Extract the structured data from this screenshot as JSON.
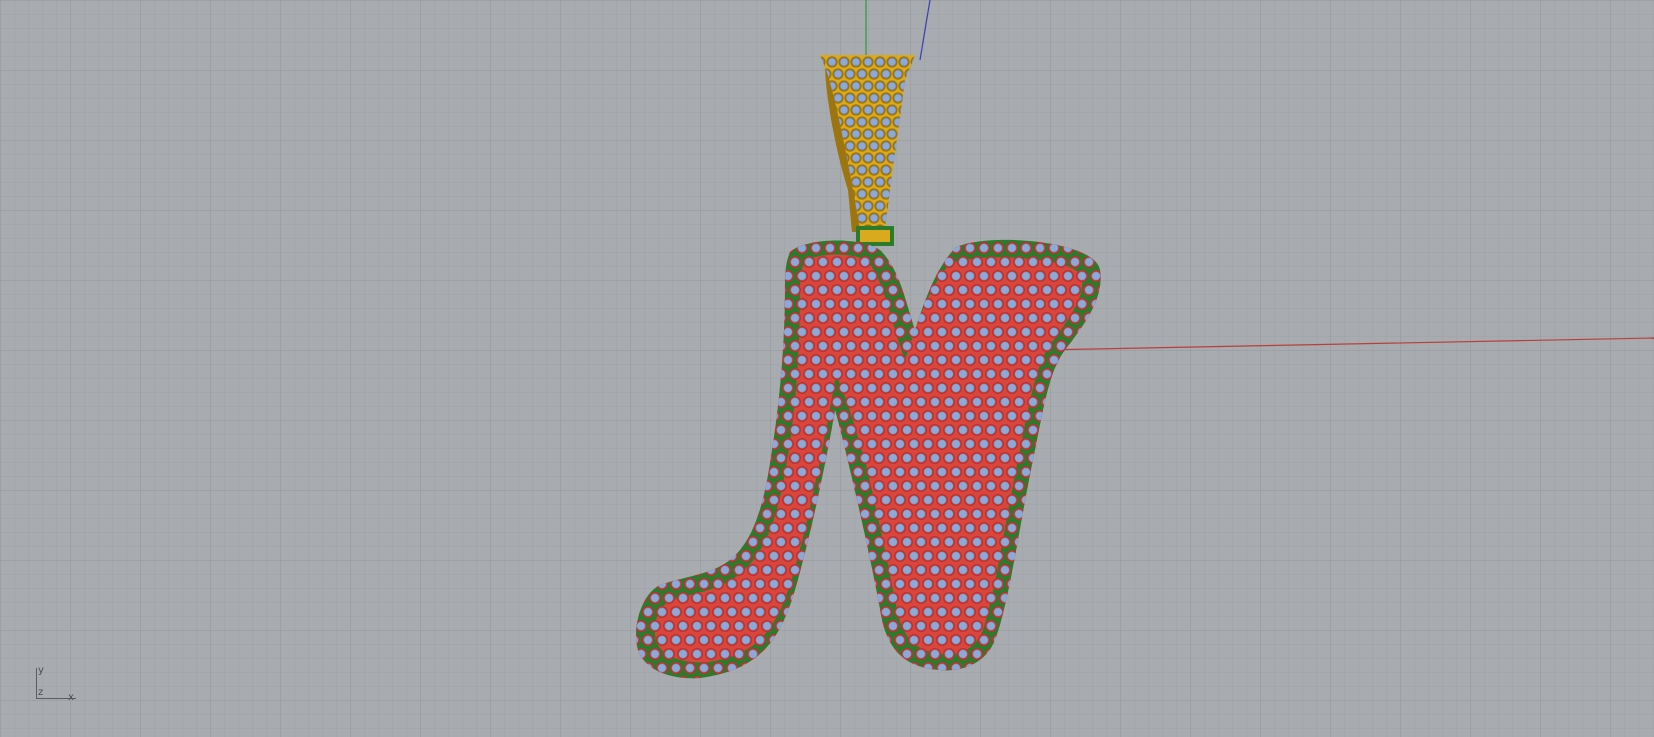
{
  "viewport": {
    "name": "Perspective",
    "background": "#a8abaf",
    "grid_minor_color": "#9ea1a5",
    "grid_major_color": "#8f9296",
    "x_axis_color": "#b8403a",
    "y_axis_color": "#2f9a3a",
    "z_axis_color": "#3a3fb0"
  },
  "model": {
    "object": "letter-n-pendant",
    "colors": {
      "bail_gold": "#d9a91e",
      "bail_gold_dark": "#9c7410",
      "body_green": "#2c7a2c",
      "body_green_light": "#3c9a3c",
      "inner_red": "#d8463e",
      "stone_blue": "#8fa9d6",
      "prong_red": "#c43028",
      "prong_green": "#2e8a2e"
    }
  },
  "gizmo": {
    "y_label": "y",
    "z_label": "z",
    "x_label": "x"
  }
}
